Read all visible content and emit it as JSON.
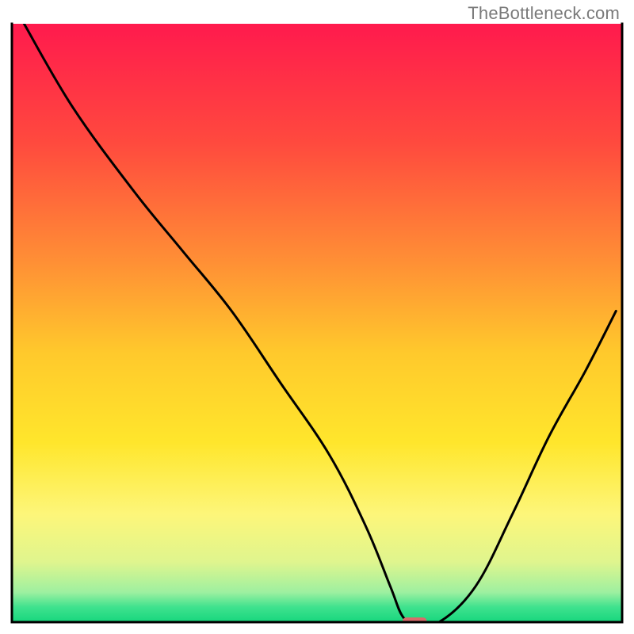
{
  "watermark": "TheBottleneck.com",
  "chart_data": {
    "type": "line",
    "title": "",
    "xlabel": "",
    "ylabel": "",
    "xlim": [
      0,
      100
    ],
    "ylim": [
      0,
      100
    ],
    "grid": false,
    "legend": false,
    "background_gradient_stops": [
      {
        "offset": 0.0,
        "color": "#ff1a4d"
      },
      {
        "offset": 0.2,
        "color": "#ff4a3e"
      },
      {
        "offset": 0.4,
        "color": "#ff9035"
      },
      {
        "offset": 0.55,
        "color": "#ffc92c"
      },
      {
        "offset": 0.7,
        "color": "#ffe62c"
      },
      {
        "offset": 0.82,
        "color": "#fdf67a"
      },
      {
        "offset": 0.9,
        "color": "#dff58e"
      },
      {
        "offset": 0.95,
        "color": "#9ef0a0"
      },
      {
        "offset": 0.975,
        "color": "#3fe28e"
      },
      {
        "offset": 1.0,
        "color": "#17d67d"
      }
    ],
    "series": [
      {
        "name": "bottleneck-curve",
        "x": [
          2,
          10,
          20,
          28,
          36,
          44,
          52,
          58,
          62,
          64,
          66,
          70,
          76,
          82,
          88,
          94,
          99
        ],
        "y": [
          100,
          86,
          72,
          62,
          52,
          40,
          28,
          16,
          6,
          1,
          0,
          0,
          6,
          18,
          31,
          42,
          52
        ]
      }
    ],
    "marker": {
      "name": "bottleneck-marker",
      "x": 66,
      "y": 0,
      "color": "#d96a6a",
      "width": 4,
      "height": 1.3
    },
    "axes": {
      "color": "#000000",
      "width": 3
    }
  }
}
